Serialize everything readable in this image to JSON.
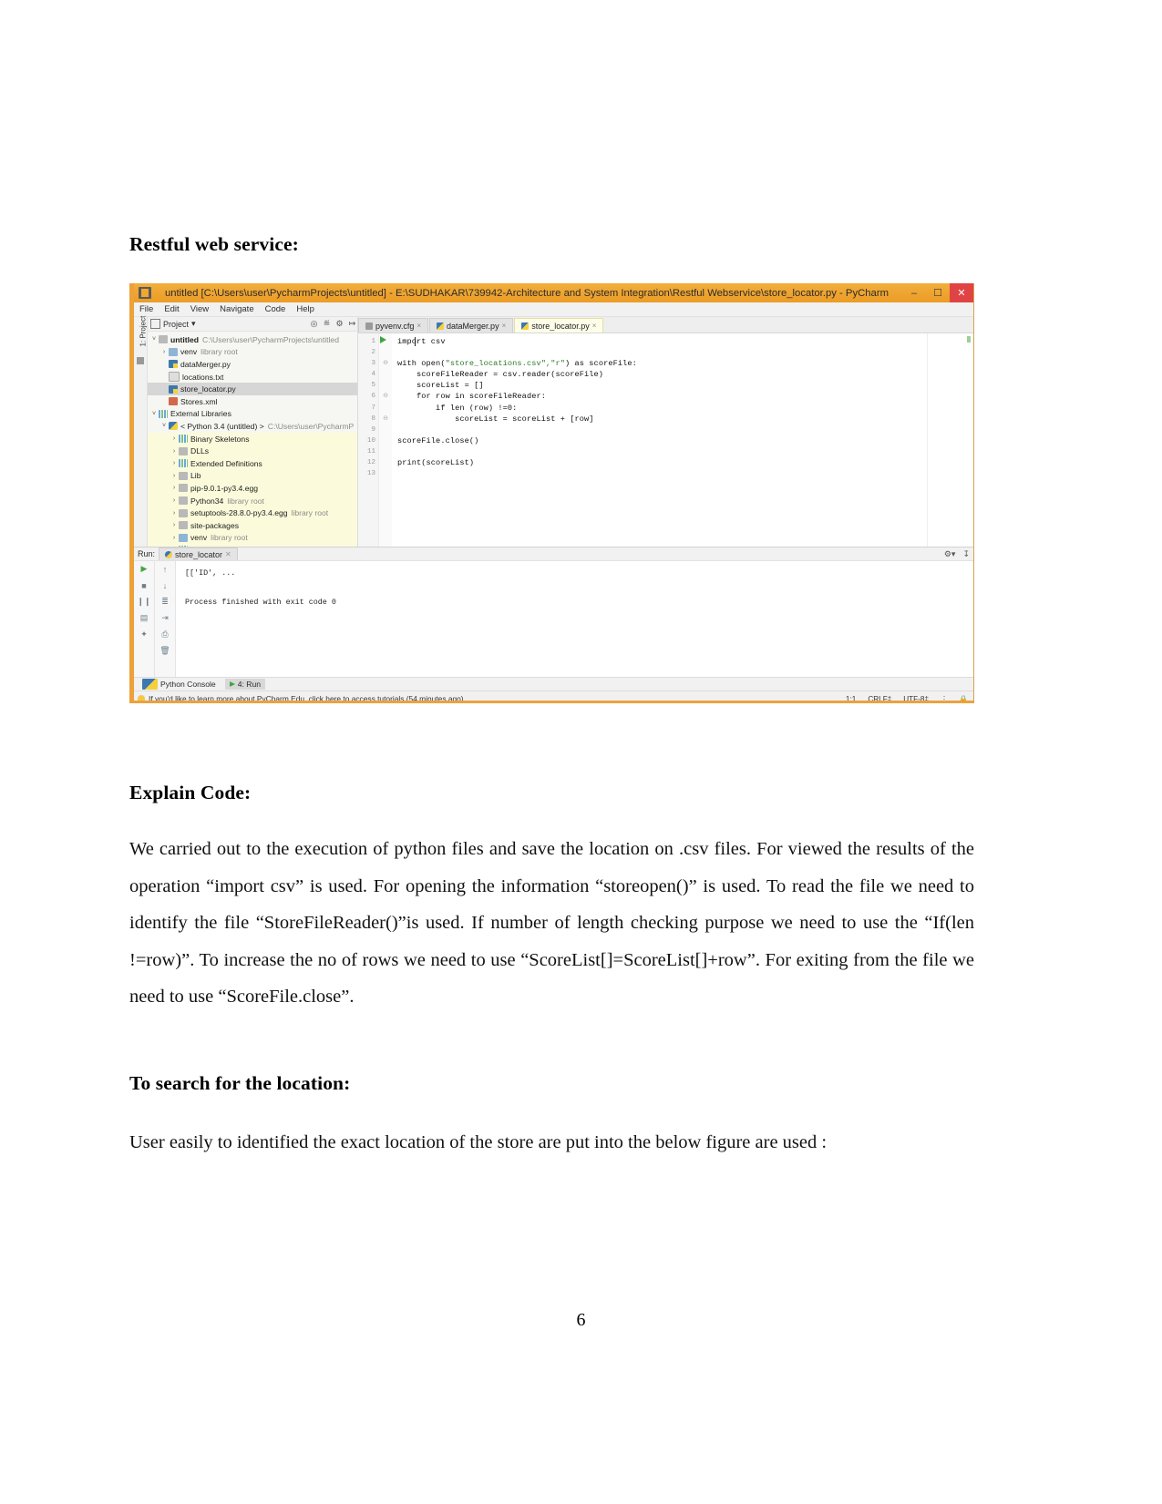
{
  "document": {
    "heading_restful": "Restful web service:",
    "heading_explain": "Explain Code:",
    "paragraph_explain": "We  carried out to the execution of python files and save the location on .csv files. For viewed the results of the operation “import csv” is used. For opening the information “storeopen()” is used. To read the file we need to identify the file    “StoreFileReader()”is  used. If number of length checking purpose we need to use the “If(len !=row)”. To increase the no of rows we need to use  “ScoreList[]=ScoreList[]+row”.  For  exiting  from  the  file  we  need  to  use “ScoreFile.close”.",
    "heading_search": "To search for the location:",
    "paragraph_search": "User easily to identified the exact location of the store are put into the below figure are used :",
    "page_number": "6"
  },
  "screenshot": {
    "window": {
      "title": "untitled [C:\\Users\\user\\PycharmProjects\\untitled] - E:\\SUDHAKAR\\739942-Architecture and System Integration\\Restful Webservice\\store_locator.py - PyCharm",
      "app_icon": "pycharm-icon",
      "minimize": "–",
      "maximize": "☐",
      "close": "✕",
      "titlebar_color": "#f0a830"
    },
    "menubar": [
      "File",
      "Edit",
      "View",
      "Navigate",
      "Code",
      "Help"
    ],
    "left_strip": {
      "label": "1: Project"
    },
    "project_pane": {
      "header_label": "Project",
      "header_caret": "▾",
      "toolbar_icons": [
        "target-icon",
        "collapse-icon",
        "settings-icon",
        "hide-icon"
      ],
      "tree": [
        {
          "arrow": "˅",
          "icon": "folder",
          "name": "untitled",
          "bold": true,
          "path": "C:\\Users\\user\\PycharmProjects\\untitled",
          "indent": 0,
          "style": ""
        },
        {
          "arrow": "›",
          "icon": "folderb",
          "name": "venv",
          "bold": false,
          "path": "library root",
          "indent": 1,
          "style": ""
        },
        {
          "arrow": "",
          "icon": "py",
          "name": "dataMerger.py",
          "bold": false,
          "path": "",
          "indent": 1,
          "style": ""
        },
        {
          "arrow": "",
          "icon": "txt",
          "name": "locations.txt",
          "bold": false,
          "path": "",
          "indent": 1,
          "style": ""
        },
        {
          "arrow": "",
          "icon": "py",
          "name": "store_locator.py",
          "bold": false,
          "path": "",
          "indent": 1,
          "style": "sel"
        },
        {
          "arrow": "",
          "icon": "xml",
          "name": "Stores.xml",
          "bold": false,
          "path": "",
          "indent": 1,
          "style": ""
        },
        {
          "arrow": "˅",
          "icon": "lib",
          "name": "External Libraries",
          "bold": false,
          "path": "",
          "indent": 0,
          "style": ""
        },
        {
          "arrow": "˅",
          "icon": "pyicon",
          "name": "< Python 3.4 (untitled) >",
          "bold": false,
          "path": "C:\\Users\\user\\PycharmP",
          "indent": 1,
          "style": ""
        },
        {
          "arrow": "›",
          "icon": "lib",
          "name": "Binary Skeletons",
          "bold": false,
          "path": "",
          "indent": 2,
          "style": "ylw"
        },
        {
          "arrow": "›",
          "icon": "folder",
          "name": "DLLs",
          "bold": false,
          "path": "",
          "indent": 2,
          "style": "ylw"
        },
        {
          "arrow": "›",
          "icon": "lib",
          "name": "Extended Definitions",
          "bold": false,
          "path": "",
          "indent": 2,
          "style": "ylw"
        },
        {
          "arrow": "›",
          "icon": "folder",
          "name": "Lib",
          "bold": false,
          "path": "",
          "indent": 2,
          "style": "ylw"
        },
        {
          "arrow": "›",
          "icon": "folder",
          "name": "pip-9.0.1-py3.4.egg",
          "bold": false,
          "path": "",
          "indent": 2,
          "style": "ylw"
        },
        {
          "arrow": "›",
          "icon": "folder",
          "name": "Python34",
          "bold": false,
          "path": "library root",
          "indent": 2,
          "style": "ylw"
        },
        {
          "arrow": "›",
          "icon": "folder",
          "name": "setuptools-28.8.0-py3.4.egg",
          "bold": false,
          "path": "library root",
          "indent": 2,
          "style": "ylw"
        },
        {
          "arrow": "›",
          "icon": "folder",
          "name": "site-packages",
          "bold": false,
          "path": "",
          "indent": 2,
          "style": "ylw"
        },
        {
          "arrow": "›",
          "icon": "folderb",
          "name": "venv",
          "bold": false,
          "path": "library root",
          "indent": 2,
          "style": "ylw"
        },
        {
          "arrow": "›",
          "icon": "lib",
          "name": "Typeshed Stubs",
          "bold": false,
          "path": "",
          "indent": 2,
          "style": "ylw"
        }
      ]
    },
    "editor": {
      "tabs": [
        {
          "label": "pyvenv.cfg",
          "icon": "cfg",
          "active": false,
          "close": "×"
        },
        {
          "label": "dataMerger.py",
          "icon": "py",
          "active": false,
          "close": "×"
        },
        {
          "label": "store_locator.py",
          "icon": "py",
          "active": true,
          "close": "×"
        }
      ],
      "line_numbers": [
        "1",
        "2",
        "3",
        "4",
        "5",
        "6",
        "7",
        "8",
        "9",
        "10",
        "11",
        "12",
        "13"
      ],
      "code_lines": [
        "import csv",
        "",
        "with open(\"store_locations.csv\",\"r\") as scoreFile:",
        "    scoreFileReader = csv.reader(scoreFile)",
        "    scoreList = []",
        "    for row in scoreFileReader:",
        "        if len (row) !=0:",
        "            scoreList = scoreList + [row]",
        "",
        "scoreFile.close()",
        "",
        "print(scoreList)",
        ""
      ]
    },
    "run_panel": {
      "label": "Run:",
      "tab_label": "store_locator",
      "output_lines": [
        "[['ID', ...",
        "",
        "Process finished with exit code 0"
      ],
      "toolbar_icons": [
        "play-icon",
        "stop-icon",
        "pause-icon",
        "rerun-icon",
        "pin-icon",
        "up-arrow-icon",
        "down-arrow-icon",
        "soft-wrap-icon",
        "scroll-end-icon",
        "print-icon",
        "trash-icon"
      ],
      "settings_icon": "gear-icon",
      "hide_icon": "hide-icon"
    },
    "bottom_tabs": [
      {
        "label": "Python Console",
        "icon": "python-console-icon",
        "active": false
      },
      {
        "label": "4: Run",
        "icon": "run-icon",
        "active": true
      }
    ],
    "status_bar": {
      "tip": "If you'd like to learn more about PyCharm Edu, click here to access tutorials (54 minutes ago)",
      "caret_position": "1:1",
      "line_separator": "CRLF‡",
      "encoding": "UTF-8‡",
      "indent_icon": "indent-icon",
      "lock_icon": "lock-icon"
    }
  }
}
